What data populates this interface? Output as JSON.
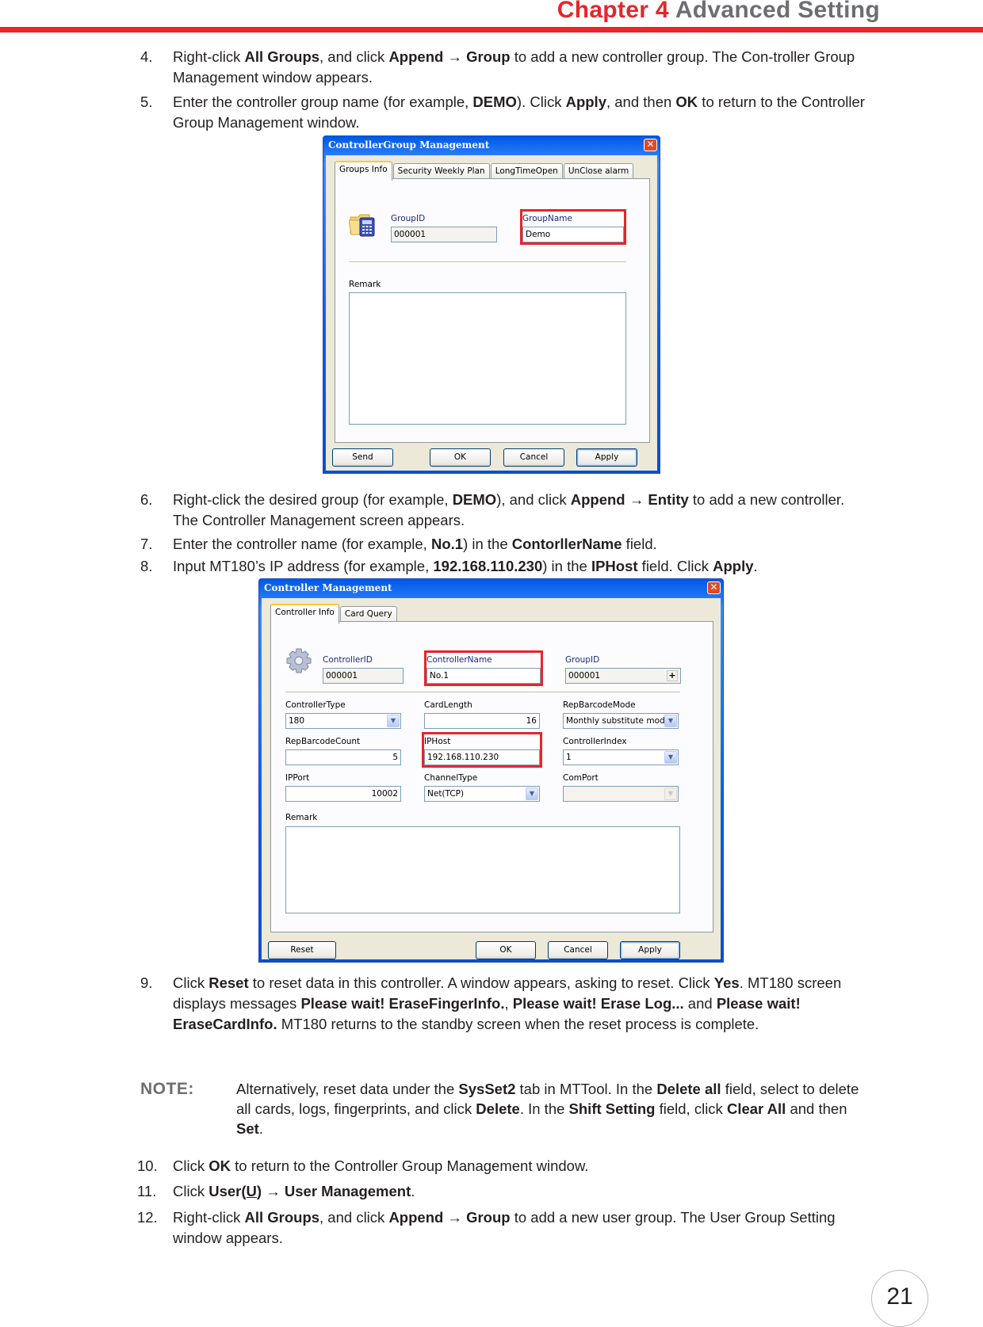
{
  "header": {
    "chapter": "Chapter 4",
    "title": "Advanced Setting",
    "accent_color": "#ed2529"
  },
  "steps_top": [
    {
      "num": "4.",
      "html": "Right-click <b>All Groups</b>, and click <b>Append</b> → <b>Group</b> to add a new controller group. The Con-troller Group Management window appears."
    },
    {
      "num": "5.",
      "html": "Enter the controller group name (for example, <b>DEMO</b>). Click <b>Apply</b>, and then <b>OK</b> to return to the Controller Group Management window."
    }
  ],
  "group_window": {
    "title": "ControllerGroup Management",
    "close_label": "✕",
    "tabs": [
      "Groups Info",
      "Security Weekly Plan",
      "LongTimeOpen",
      "UnClose alarm"
    ],
    "active_tab": "Groups Info",
    "icon": "folder-calculator-icon",
    "group_id_label": "GroupID",
    "group_id_value": "000001",
    "group_name_label": "GroupName",
    "group_name_value": "Demo",
    "remark_label": "Remark",
    "remark_value": "",
    "buttons": {
      "send": "Send",
      "ok": "OK",
      "cancel": "Cancel",
      "apply": "Apply"
    }
  },
  "steps_mid": [
    {
      "num": "6.",
      "html": "Right-click the desired group (for example, <b>DEMO</b>), and click <b>Append</b> → <b>Entity</b> to add a new controller. The Controller Management screen appears."
    },
    {
      "num": "7.",
      "html": "Enter the controller name (for example, <b>No.1</b>) in the <b>ContorllerName</b> field."
    },
    {
      "num": "8.",
      "html": "Input MT180’s IP address (for example, <b>192.168.110.230</b>) in the <b>IPHost</b> field. Click <b>Apply</b>."
    }
  ],
  "controller_window": {
    "title": "Controller Management",
    "close_label": "✕",
    "tabs": [
      "Controller Info",
      "Card Query"
    ],
    "active_tab": "Controller Info",
    "icon": "gear-icon",
    "fields": {
      "controller_id": {
        "label": "ControllerID",
        "value": "000001"
      },
      "controller_name": {
        "label": "ControllerName",
        "value": "No.1"
      },
      "group_id": {
        "label": "GroupID",
        "value": "000001"
      },
      "controller_type": {
        "label": "ControllerType",
        "value": "180"
      },
      "card_length": {
        "label": "CardLength",
        "value": "16"
      },
      "rep_barcode_mode": {
        "label": "RepBarcodeMode",
        "value": "Monthly substitute mode"
      },
      "rep_barcode_count": {
        "label": "RepBarcodeCount",
        "value": "5"
      },
      "ip_host": {
        "label": "IPHost",
        "value": "192.168.110.230"
      },
      "controller_index": {
        "label": "ControllerIndex",
        "value": "1"
      },
      "ip_port": {
        "label": "IPPort",
        "value": "10002"
      },
      "channel_type": {
        "label": "ChannelType",
        "value": "Net(TCP)"
      },
      "com_port": {
        "label": "ComPort",
        "value": ""
      },
      "remark": {
        "label": "Remark",
        "value": ""
      }
    },
    "plus_label": "+",
    "dropdown_glyph": "▼",
    "buttons": {
      "reset": "Reset",
      "ok": "OK",
      "cancel": "Cancel",
      "apply": "Apply"
    }
  },
  "step9": {
    "num": "9.",
    "html": "Click <b>Reset</b> to reset data in this controller. A window appears, asking to reset. Click <b>Yes</b>. MT180 screen displays messages <b>Please wait! EraseFingerInfo.</b>, <b>Please wait! Erase Log...</b> and <b>Please wait! EraseCardInfo.</b> MT180 returns to the standby screen when the reset process is complete."
  },
  "note": {
    "label": "NOTE:",
    "html": "Alternatively, reset data under the <b>SysSet2</b> tab in MTTool. In the <b>Delete all</b> field, select to delete all cards, logs, fingerprints, and click <b>Delete</b>. In the <b>Shift Setting</b> field, click <b>Clear All</b> and then <b>Set</b>."
  },
  "steps_bottom": [
    {
      "num": "10.",
      "html": "Click <b>OK</b> to return to the Controller Group Management window."
    },
    {
      "num": "11.",
      "html": "Click <b>User(<u>U</u>)</b> → <b>User Management</b>."
    },
    {
      "num": "12.",
      "html": "Right-click <b>All Groups</b>, and click <b>Append</b> → <b>Group</b> to add a new user group. The User Group Setting window appears."
    }
  ],
  "page_number": "21"
}
